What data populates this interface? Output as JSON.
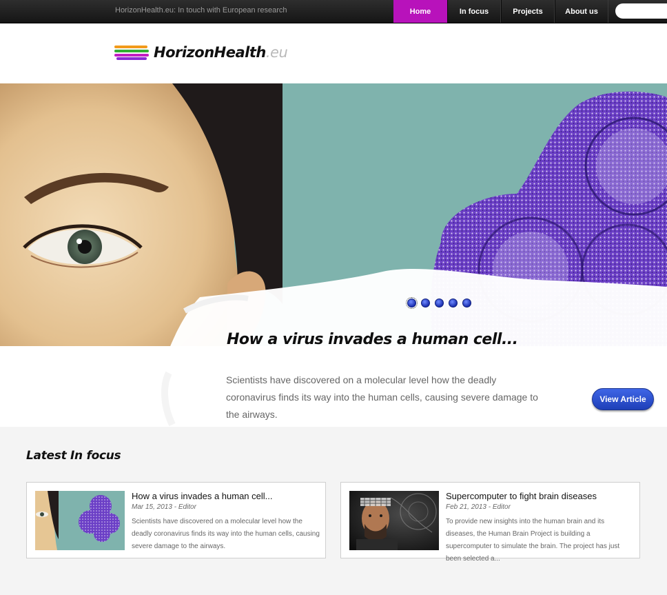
{
  "topbar": {
    "tagline": "HorizonHealth.eu: In touch with European research",
    "nav": [
      {
        "label": "Home",
        "active": true
      },
      {
        "label": "In focus",
        "active": false
      },
      {
        "label": "Projects",
        "active": false
      },
      {
        "label": "About us",
        "active": false
      }
    ],
    "search_placeholder": ""
  },
  "logo": {
    "name": "HorizonHealth",
    "tld": ".eu",
    "stripe_colors": [
      "#f29a1a",
      "#32b033",
      "#c21fc1",
      "#8a2bd6"
    ]
  },
  "hero": {
    "title": "How a virus invades a human cell...",
    "text": "Scientists have discovered on a molecular level how the deadly coronavirus finds its way into the human cells, causing severe damage to the airways.",
    "button": "View Article",
    "slide_count": 5,
    "active_slide": 1
  },
  "latest": {
    "heading": "Latest In focus",
    "cards": [
      {
        "title": "How a virus invades a human cell...",
        "meta": "Mar 15, 2013 - Editor",
        "excerpt": "Scientists have discovered on a molecular level how the deadly coronavirus finds its way into the human cells, causing severe damage to the airways."
      },
      {
        "title": "Supercomputer to fight brain diseases",
        "meta": "Feb 21, 2013 - Editor",
        "excerpt": "To provide new insights into the human brain and its diseases, the Human Brain Project is building a supercomputer to simulate the brain. The project has just been selected a..."
      }
    ]
  },
  "colors": {
    "accent": "#b812bb",
    "button_blue": "#2848c8",
    "hero_teal": "#7fb3ad",
    "virus_purple": "#6a3bc2"
  }
}
